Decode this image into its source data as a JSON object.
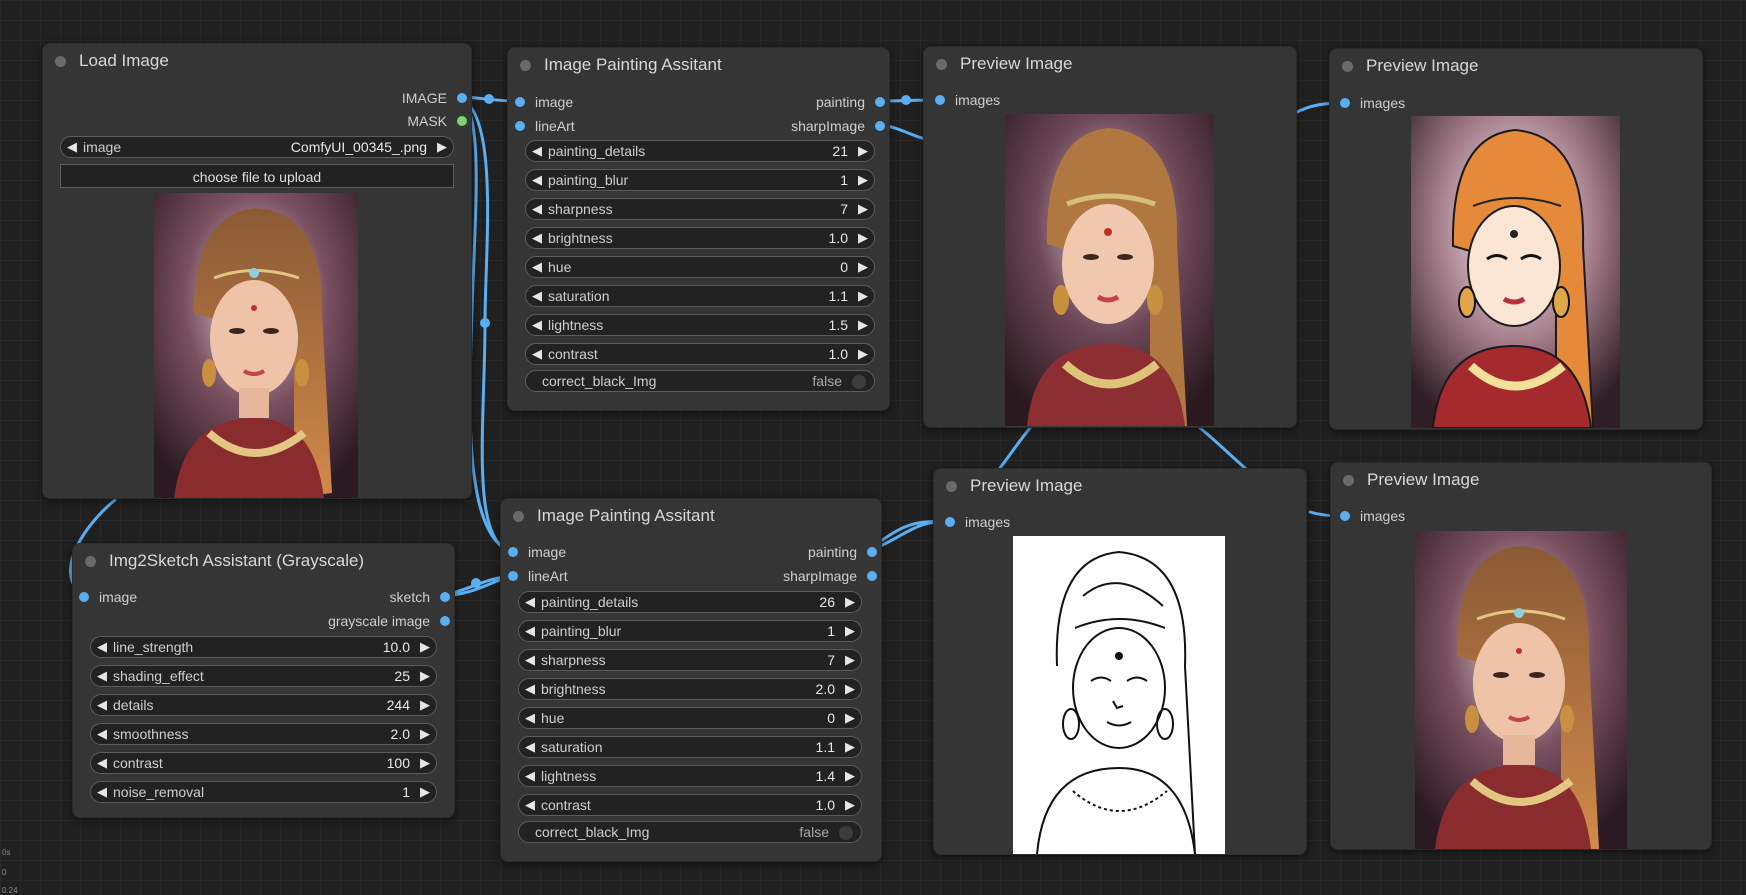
{
  "colors": {
    "wire": "#5aaef2",
    "canvas": "#202020",
    "node": "#353535",
    "mask_slot": "#7ed36e"
  },
  "load_image": {
    "title": "Load Image",
    "out_image": "IMAGE",
    "out_mask": "MASK",
    "image_label": "image",
    "image_value": "ComfyUI_00345_.png",
    "upload_label": "choose file to upload"
  },
  "painting_top": {
    "title": "Image Painting Assitant",
    "in_image": "image",
    "in_lineart": "lineArt",
    "out_painting": "painting",
    "out_sharp": "sharpImage",
    "widgets": [
      {
        "label": "painting_details",
        "value": "21"
      },
      {
        "label": "painting_blur",
        "value": "1"
      },
      {
        "label": "sharpness",
        "value": "7"
      },
      {
        "label": "brightness",
        "value": "1.0"
      },
      {
        "label": "hue",
        "value": "0"
      },
      {
        "label": "saturation",
        "value": "1.1"
      },
      {
        "label": "lightness",
        "value": "1.5"
      },
      {
        "label": "contrast",
        "value": "1.0"
      }
    ],
    "toggle": {
      "label": "correct_black_Img",
      "value": "false"
    }
  },
  "painting_bottom": {
    "title": "Image Painting Assitant",
    "in_image": "image",
    "in_lineart": "lineArt",
    "out_painting": "painting",
    "out_sharp": "sharpImage",
    "widgets": [
      {
        "label": "painting_details",
        "value": "26"
      },
      {
        "label": "painting_blur",
        "value": "1"
      },
      {
        "label": "sharpness",
        "value": "7"
      },
      {
        "label": "brightness",
        "value": "2.0"
      },
      {
        "label": "hue",
        "value": "0"
      },
      {
        "label": "saturation",
        "value": "1.1"
      },
      {
        "label": "lightness",
        "value": "1.4"
      },
      {
        "label": "contrast",
        "value": "1.0"
      }
    ],
    "toggle": {
      "label": "correct_black_Img",
      "value": "false"
    }
  },
  "sketch": {
    "title": "Img2Sketch Assistant (Grayscale)",
    "in_image": "image",
    "out_sketch": "sketch",
    "out_gray": "grayscale image",
    "widgets": [
      {
        "label": "line_strength",
        "value": "10.0"
      },
      {
        "label": "shading_effect",
        "value": "25"
      },
      {
        "label": "details",
        "value": "244"
      },
      {
        "label": "smoothness",
        "value": "2.0"
      },
      {
        "label": "contrast",
        "value": "100"
      },
      {
        "label": "noise_removal",
        "value": "1"
      }
    ]
  },
  "previews": [
    {
      "title": "Preview Image",
      "input": "images",
      "style": "painted"
    },
    {
      "title": "Preview Image",
      "input": "images",
      "style": "sharpened"
    },
    {
      "title": "Preview Image",
      "input": "images",
      "style": "sketch"
    },
    {
      "title": "Preview Image",
      "input": "images",
      "style": "photo"
    }
  ],
  "corner_stats": [
    "0s",
    "0",
    "0.24"
  ]
}
